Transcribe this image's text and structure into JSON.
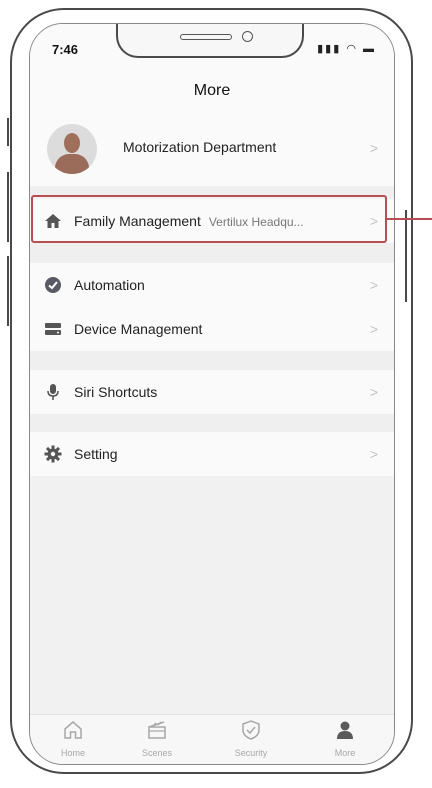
{
  "status_bar": {
    "time": "7:46",
    "icons": "signal wifi battery"
  },
  "header": {
    "title": "More"
  },
  "profile": {
    "name": "Motorization Department"
  },
  "menu": {
    "family_management": {
      "label": "Family Management",
      "value": "Vertilux Headqu..."
    },
    "automation": {
      "label": "Automation"
    },
    "device_management": {
      "label": "Device Management"
    },
    "siri_shortcuts": {
      "label": "Siri Shortcuts"
    },
    "setting": {
      "label": "Setting"
    }
  },
  "chevron": ">",
  "tabbar": {
    "tabs": [
      {
        "label": "Home",
        "icon": "home-icon"
      },
      {
        "label": "Scenes",
        "icon": "scenes-icon"
      },
      {
        "label": "Security",
        "icon": "shield-icon"
      },
      {
        "label": "More",
        "icon": "user-icon"
      }
    ]
  },
  "colors": {
    "highlight": "#b64e54",
    "active_tab": "#5a5a5a",
    "inactive_tab": "#a7a7a7"
  }
}
